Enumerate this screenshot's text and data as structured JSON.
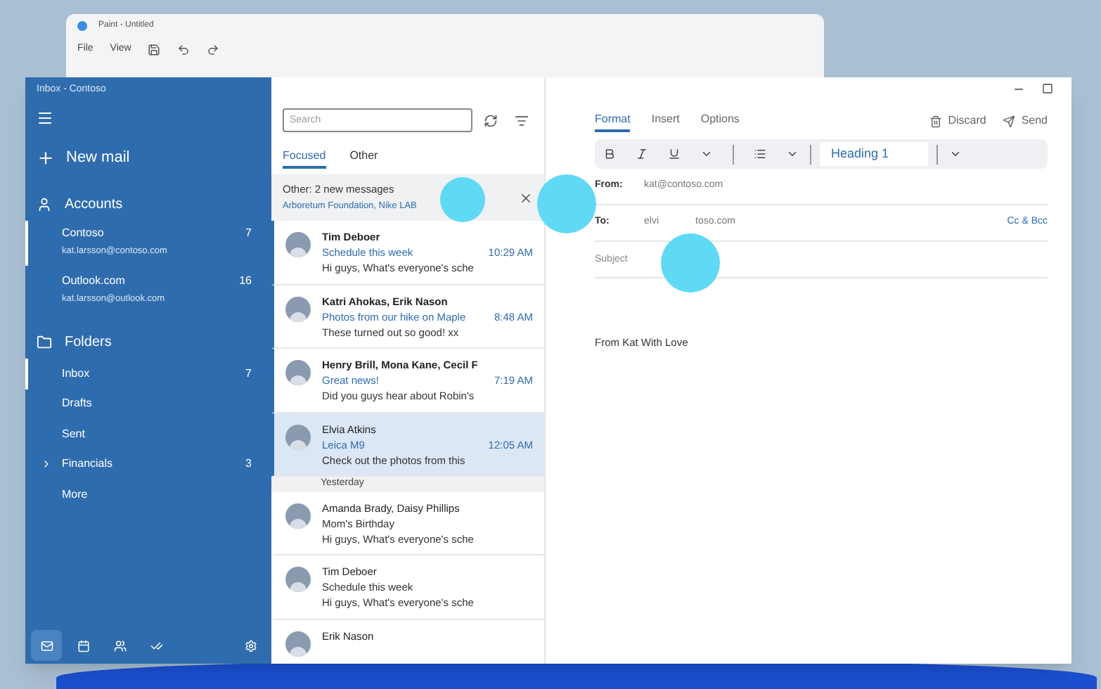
{
  "background_window": {
    "title": "Paint - Untitled",
    "menu": [
      "File",
      "View"
    ]
  },
  "window": {
    "title": "Inbox - Contoso"
  },
  "sidebar": {
    "new_mail": "New mail",
    "accounts_heading": "Accounts",
    "accounts": [
      {
        "name": "Contoso",
        "email": "kat.larsson@contoso.com",
        "count": "7",
        "selected": true
      },
      {
        "name": "Outlook.com",
        "email": "kat.larsson@outlook.com",
        "count": "16",
        "selected": false
      }
    ],
    "folders_heading": "Folders",
    "folders": [
      {
        "name": "Inbox",
        "count": "7",
        "selected": true,
        "expandable": false
      },
      {
        "name": "Drafts",
        "selected": false,
        "expandable": false
      },
      {
        "name": "Sent",
        "selected": false,
        "expandable": false
      },
      {
        "name": "Financials",
        "count": "3",
        "selected": false,
        "expandable": true
      },
      {
        "name": "More",
        "selected": false,
        "expandable": false
      }
    ],
    "bottom_nav": [
      {
        "kind": "mail",
        "selected": true
      },
      {
        "kind": "calendar",
        "selected": false
      },
      {
        "kind": "people",
        "selected": false
      },
      {
        "kind": "todo",
        "selected": false
      },
      {
        "kind": "settings",
        "selected": false
      }
    ]
  },
  "message_list": {
    "search": {
      "placeholder": "Search"
    },
    "tabs": [
      {
        "label": "Focused",
        "selected": true
      },
      {
        "label": "Other",
        "selected": false
      }
    ],
    "banner": {
      "title": "Other: 2 new messages",
      "senders": "Arboretum Foundation, Nike LAB"
    },
    "items": [
      {
        "kind": "message",
        "sender": "Tim Deboer",
        "subject": "Schedule this week",
        "time": "10:29 AM",
        "preview": "Hi guys, What's everyone's sche",
        "unread": true,
        "selected": false
      },
      {
        "kind": "message",
        "sender": "Katri Ahokas, Erik Nason",
        "subject": "Photos from our hike on Maple",
        "time": "8:48 AM",
        "preview": "These turned out so good! xx",
        "unread": true,
        "selected": false
      },
      {
        "kind": "message",
        "sender": "Henry Brill, Mona Kane, Cecil F",
        "subject": "Great news!",
        "time": "7:19 AM",
        "preview": "Did you guys hear about Robin's",
        "unread": true,
        "selected": false
      },
      {
        "kind": "message",
        "sender": "Elvia Atkins",
        "subject": "Leica M9",
        "time": "12:05 AM",
        "preview": "Check out the photos from this",
        "unread": false,
        "selected": true
      },
      {
        "kind": "header",
        "label": "Yesterday"
      },
      {
        "kind": "message",
        "sender": "Amanda Brady, Daisy Phillips",
        "subject": "Mom's Birthday",
        "preview": "Hi guys, What's everyone's sche",
        "unread": false,
        "selected": false
      },
      {
        "kind": "message",
        "sender": "Tim Deboer",
        "subject": "Schedule this week",
        "preview": "Hi guys, What's everyone's sche",
        "unread": false,
        "selected": false
      },
      {
        "kind": "message",
        "sender": "Erik Nason",
        "unread": false,
        "selected": false
      }
    ]
  },
  "compose": {
    "tabs": [
      {
        "label": "Format",
        "selected": true
      },
      {
        "label": "Insert",
        "selected": false
      },
      {
        "label": "Options",
        "selected": false
      }
    ],
    "discard": "Discard",
    "send": "Send",
    "toolbar": {
      "style": "Heading 1"
    },
    "from": {
      "label": "From:",
      "value": "kat@contoso.com"
    },
    "to": {
      "label": "To:",
      "value_parts": [
        "elvi",
        "toso.com"
      ],
      "cc_bcc": "Cc & Bcc"
    },
    "subject": {
      "placeholder": "Subject"
    },
    "body": "From Kat With Love"
  }
}
